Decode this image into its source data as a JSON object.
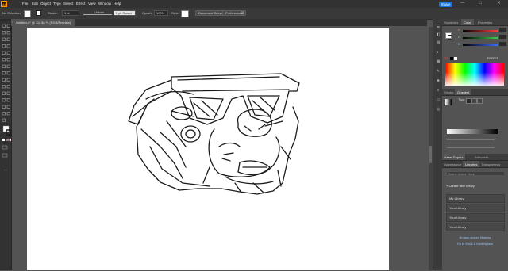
{
  "menubar": {
    "app_logo": "Ai",
    "items": [
      "File",
      "Edit",
      "Object",
      "Type",
      "Select",
      "Effect",
      "View",
      "Window",
      "Help"
    ],
    "share_label": "Share",
    "window_buttons": [
      "—",
      "□",
      "✕"
    ]
  },
  "controlbar": {
    "selection_label": "No Selection",
    "stroke_label": "Stroke:",
    "stroke_weight": "1 pt",
    "brush_label": "Uniform",
    "brush_profile": "5 pt. Round",
    "opacity_label": "Opacity:",
    "opacity_value": "100%",
    "style_label": "Style:",
    "document_setup": "Document Setup",
    "preferences": "Preferences"
  },
  "document_tab": {
    "title": "Untitled-1* @ 111.58 % (RGB/Preview)",
    "close": "×"
  },
  "color_panel": {
    "tabs": [
      "Swatches",
      "Color",
      "Properties"
    ],
    "active_tab": "Color",
    "channels": [
      {
        "label": "R",
        "color": "#ff3b3b",
        "value": ""
      },
      {
        "label": "G",
        "color": "#37d14b",
        "value": ""
      },
      {
        "label": "B",
        "color": "#3b6dff",
        "value": ""
      }
    ],
    "hex_value": "FFFFFF"
  },
  "gradient_panel": {
    "tabs": [
      "Stroke",
      "Gradient"
    ],
    "active_tab": "Gradient",
    "type_label": "Type:"
  },
  "libraries_panel": {
    "top_tabs": [
      "Appearance",
      "Libraries",
      "Transparency"
    ],
    "mid_tabs": [
      "Appearance",
      "Libraries",
      "Transparency"
    ],
    "active_tab": "Libraries",
    "header_tabs": [
      "Asset Export",
      "Artboards"
    ],
    "search_placeholder": "Search Adobe Stock",
    "create_label": "Create new library",
    "libraries": [
      "My Library",
      "Your Library",
      "Your Library",
      "Your Library"
    ],
    "link_browse": "Browse shared libraries",
    "link_cc": "Go to Stock & Marketplace"
  },
  "icons": {
    "toolbar_tools": [
      "selection-tool",
      "direct-selection-tool",
      "magic-wand-tool",
      "lasso-tool",
      "pen-tool",
      "curvature-tool",
      "type-tool",
      "line-tool",
      "rectangle-tool",
      "paintbrush-tool",
      "pencil-tool",
      "shaper-tool",
      "eraser-tool",
      "rotate-tool",
      "scale-tool",
      "width-tool",
      "free-transform-tool",
      "shape-builder-tool",
      "perspective-tool",
      "mesh-tool",
      "gradient-tool",
      "eyedropper-tool",
      "blend-tool",
      "symbol-sprayer-tool",
      "graph-tool",
      "artboard-tool",
      "slice-tool",
      "hand-tool",
      "zoom-tool"
    ]
  }
}
